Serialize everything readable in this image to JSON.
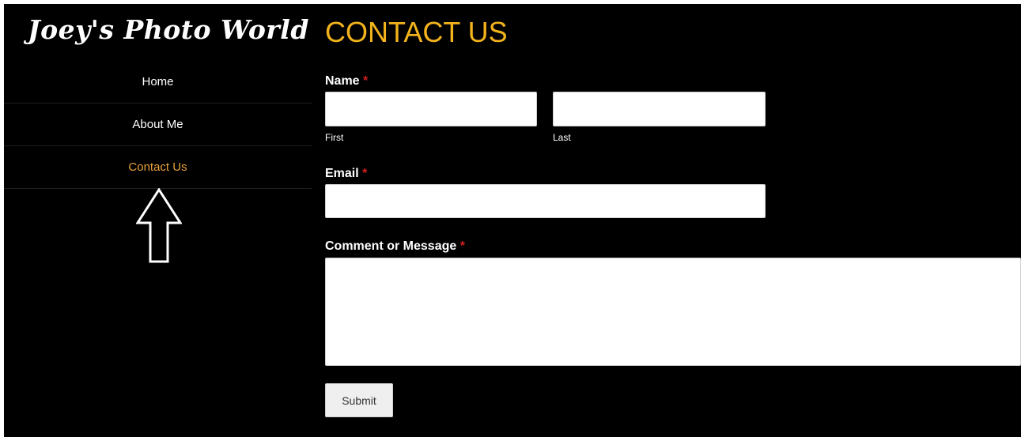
{
  "site": {
    "logo_text": "Joey's Photo World"
  },
  "nav": {
    "items": [
      {
        "label": "Home"
      },
      {
        "label": "About Me"
      },
      {
        "label": "Contact Us"
      }
    ],
    "active_index": 2
  },
  "annotation": {
    "icon": "up-arrow-icon"
  },
  "page": {
    "title": "CONTACT US"
  },
  "form": {
    "name": {
      "label": "Name",
      "required_mark": "*",
      "first": {
        "value": "",
        "sublabel": "First"
      },
      "last": {
        "value": "",
        "sublabel": "Last"
      }
    },
    "email": {
      "label": "Email",
      "required_mark": "*",
      "value": ""
    },
    "message": {
      "label": "Comment or Message",
      "required_mark": "*",
      "value": ""
    },
    "submit_label": "Submit"
  },
  "colors": {
    "background": "#000000",
    "title": "#f2b31c",
    "active_nav": "#e8a33a",
    "required": "#d21f1f"
  }
}
